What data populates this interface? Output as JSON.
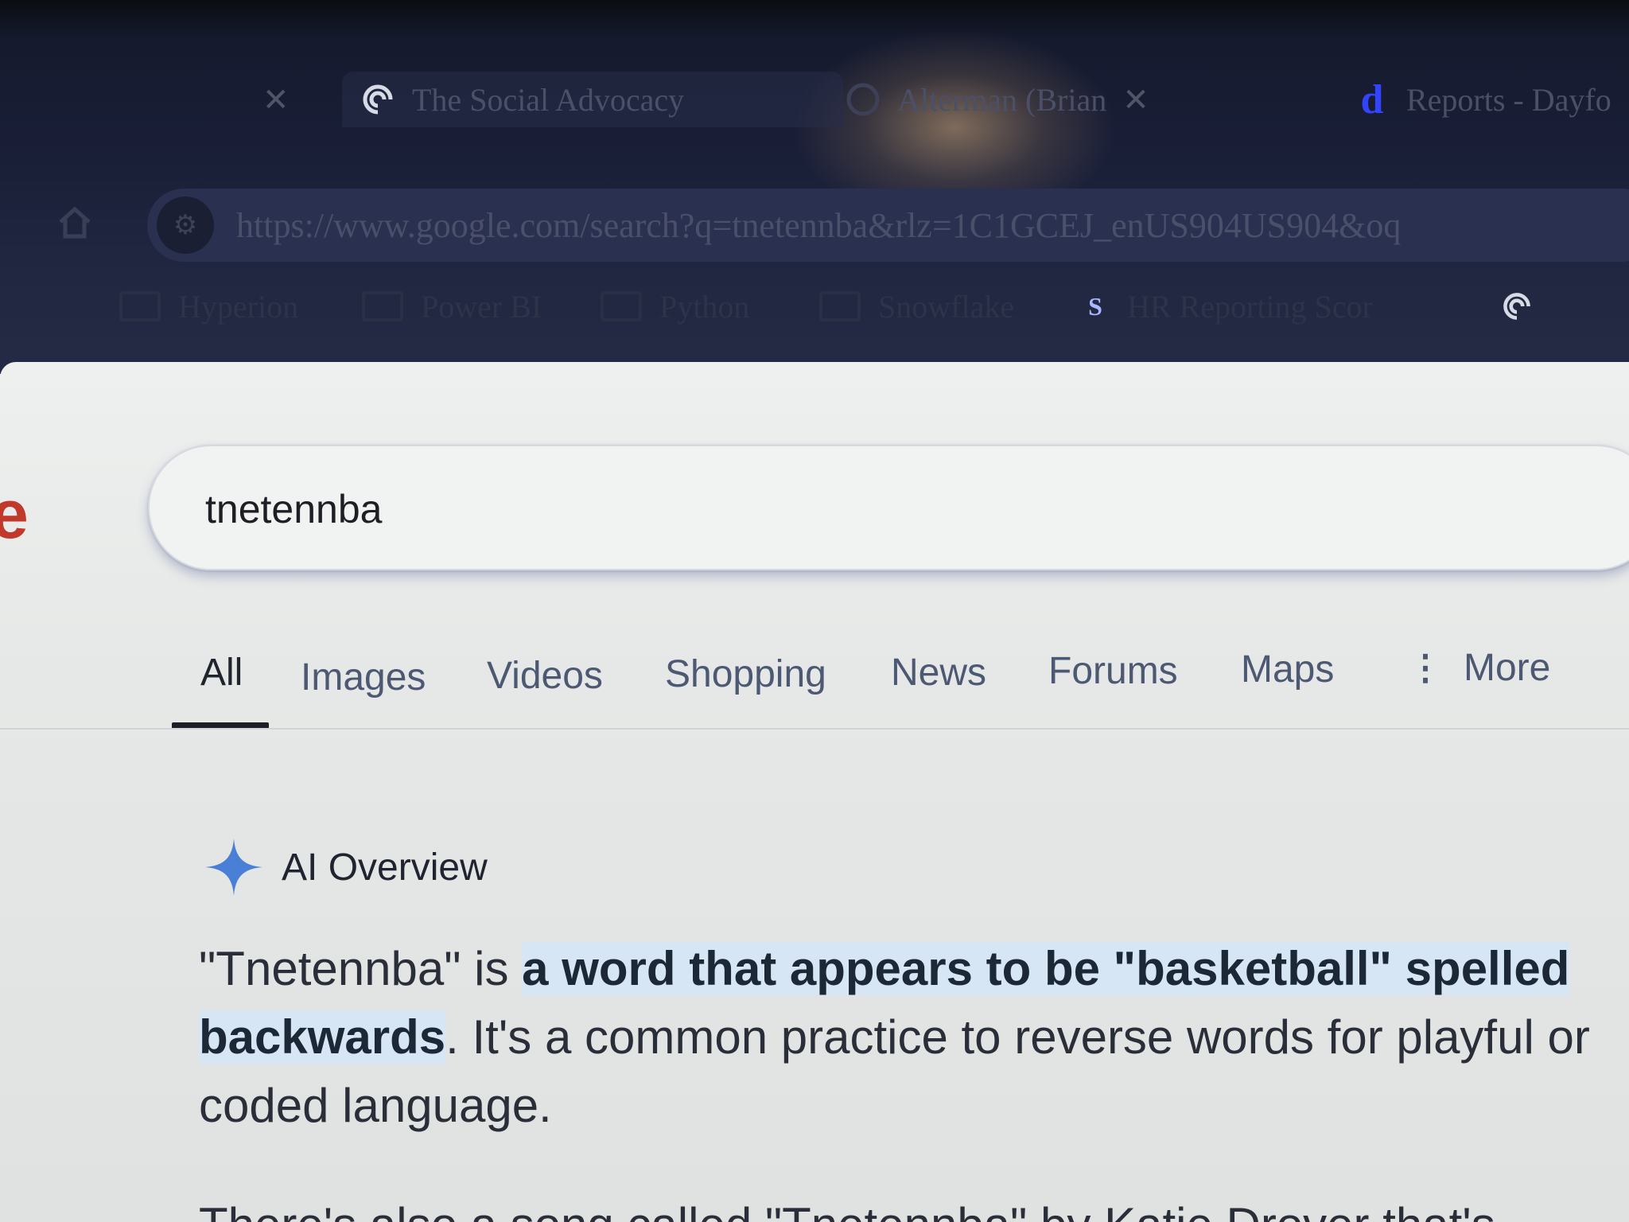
{
  "browser": {
    "tabs": [
      {
        "title": "The Social Advocacy",
        "icon": "swirl-icon",
        "active": false
      },
      {
        "title": "Alterman (Brian",
        "icon": "github-icon",
        "active": false
      },
      {
        "title": "Reports - Dayfo",
        "icon": "d-icon",
        "active": false
      }
    ],
    "address_bar": {
      "url": "https://www.google.com/search?q=tnetennba&rlz=1C1GCEJ_enUS904US904&oq"
    },
    "bookmarks": [
      {
        "label": "Hyperion",
        "icon": "folder-icon"
      },
      {
        "label": "Power BI",
        "icon": "folder-icon"
      },
      {
        "label": "Python",
        "icon": "folder-icon"
      },
      {
        "label": "Snowflake",
        "icon": "folder-icon"
      },
      {
        "label": "HR Reporting Scor",
        "icon": "s-app-icon"
      }
    ]
  },
  "search": {
    "logo_fragment": "e",
    "query": "tnetennba"
  },
  "nav_tabs": [
    {
      "label": "All",
      "active": true
    },
    {
      "label": "Images",
      "active": false
    },
    {
      "label": "Videos",
      "active": false
    },
    {
      "label": "Shopping",
      "active": false
    },
    {
      "label": "News",
      "active": false
    },
    {
      "label": "Forums",
      "active": false
    },
    {
      "label": "Maps",
      "active": false
    },
    {
      "label": "More",
      "active": false,
      "icon": "vertical-dots-icon"
    }
  ],
  "ai_overview": {
    "title": "AI Overview",
    "icon": "sparkle-icon",
    "accent_color": "#4a7fd8",
    "paragraph": {
      "part1": "\"Tnetennba\" is ",
      "highlight": "a word that appears to be \"basketball\" spelled backwards",
      "part2": ". It's a common practice to reverse words for playful or coded language."
    },
    "next_paragraph_partial": "There's also a song called \"Tnetennba\" by Katie Drover that's"
  }
}
